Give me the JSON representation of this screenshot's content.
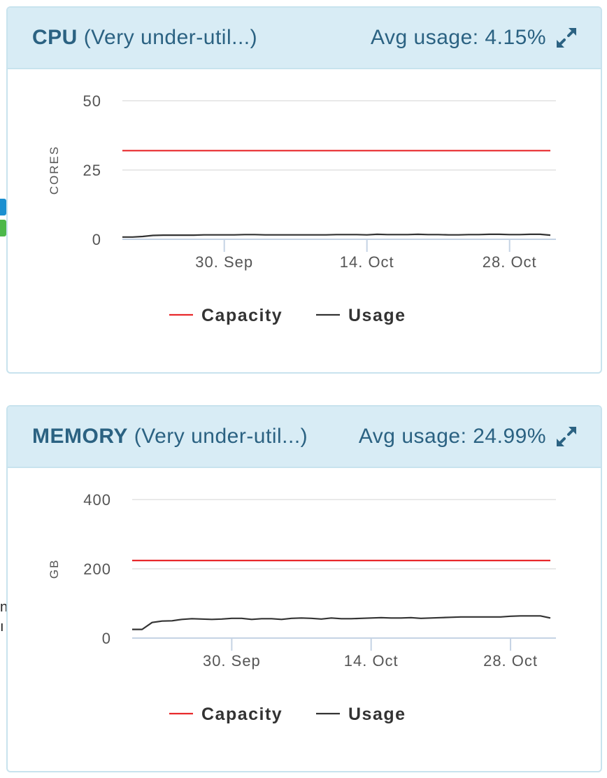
{
  "colors": {
    "capacity": "#e8292b",
    "usage": "#333333",
    "header_bg": "#d8ecf5",
    "header_text": "#2b6282",
    "edge_blue": "#1a8fd0",
    "edge_green": "#4cb84a"
  },
  "icons": {
    "expand": "expand-arrows-icon"
  },
  "edge_fragments": [
    "n",
    "ı"
  ],
  "panels": [
    {
      "name": "CPU",
      "status": "(Very under-util...)",
      "avg_usage_text": "Avg usage: 4.15%"
    },
    {
      "name": "MEMORY",
      "status": "(Very under-util...)",
      "avg_usage_text": "Avg usage: 24.99%"
    }
  ],
  "chart_data": [
    {
      "type": "line",
      "title": "CPU (Very under-util...)",
      "xlabel": "",
      "ylabel": "CORES",
      "ylim": [
        0,
        50
      ],
      "yticks": [
        0,
        25,
        50
      ],
      "xticks": [
        "30. Sep",
        "14. Oct",
        "28. Oct"
      ],
      "grid": true,
      "legend": "bottom-center",
      "series": [
        {
          "name": "Capacity",
          "color": "#e8292b",
          "x": [
            "2019-09-20",
            "2019-11-01"
          ],
          "values": [
            32,
            32
          ]
        },
        {
          "name": "Usage",
          "color": "#333333",
          "x": [
            "2019-09-20",
            "2019-09-21",
            "2019-09-22",
            "2019-09-23",
            "2019-09-24",
            "2019-09-25",
            "2019-09-26",
            "2019-09-27",
            "2019-09-28",
            "2019-09-29",
            "2019-09-30",
            "2019-10-01",
            "2019-10-02",
            "2019-10-03",
            "2019-10-04",
            "2019-10-05",
            "2019-10-06",
            "2019-10-07",
            "2019-10-08",
            "2019-10-09",
            "2019-10-10",
            "2019-10-11",
            "2019-10-12",
            "2019-10-13",
            "2019-10-14",
            "2019-10-15",
            "2019-10-16",
            "2019-10-17",
            "2019-10-18",
            "2019-10-19",
            "2019-10-20",
            "2019-10-21",
            "2019-10-22",
            "2019-10-23",
            "2019-10-24",
            "2019-10-25",
            "2019-10-26",
            "2019-10-27",
            "2019-10-28",
            "2019-10-29",
            "2019-10-30",
            "2019-10-31",
            "2019-11-01"
          ],
          "values": [
            0.8,
            0.8,
            1.0,
            1.4,
            1.5,
            1.5,
            1.5,
            1.5,
            1.6,
            1.6,
            1.6,
            1.6,
            1.7,
            1.7,
            1.6,
            1.6,
            1.6,
            1.6,
            1.6,
            1.6,
            1.6,
            1.7,
            1.7,
            1.7,
            1.6,
            1.8,
            1.7,
            1.7,
            1.7,
            1.8,
            1.7,
            1.7,
            1.6,
            1.6,
            1.7,
            1.7,
            1.8,
            1.8,
            1.7,
            1.7,
            1.8,
            1.8,
            1.5
          ]
        }
      ]
    },
    {
      "type": "line",
      "title": "MEMORY (Very under-util...)",
      "xlabel": "",
      "ylabel": "GB",
      "ylim": [
        0,
        400
      ],
      "yticks": [
        0,
        200,
        400
      ],
      "xticks": [
        "30. Sep",
        "14. Oct",
        "28. Oct"
      ],
      "grid": true,
      "legend": "bottom-center",
      "series": [
        {
          "name": "Capacity",
          "color": "#e8292b",
          "x": [
            "2019-09-20",
            "2019-11-01"
          ],
          "values": [
            224,
            224
          ]
        },
        {
          "name": "Usage",
          "color": "#333333",
          "x": [
            "2019-09-20",
            "2019-09-21",
            "2019-09-22",
            "2019-09-23",
            "2019-09-24",
            "2019-09-25",
            "2019-09-26",
            "2019-09-27",
            "2019-09-28",
            "2019-09-29",
            "2019-09-30",
            "2019-10-01",
            "2019-10-02",
            "2019-10-03",
            "2019-10-04",
            "2019-10-05",
            "2019-10-06",
            "2019-10-07",
            "2019-10-08",
            "2019-10-09",
            "2019-10-10",
            "2019-10-11",
            "2019-10-12",
            "2019-10-13",
            "2019-10-14",
            "2019-10-15",
            "2019-10-16",
            "2019-10-17",
            "2019-10-18",
            "2019-10-19",
            "2019-10-20",
            "2019-10-21",
            "2019-10-22",
            "2019-10-23",
            "2019-10-24",
            "2019-10-25",
            "2019-10-26",
            "2019-10-27",
            "2019-10-28",
            "2019-10-29",
            "2019-10-30",
            "2019-10-31",
            "2019-11-01"
          ],
          "values": [
            25,
            25,
            45,
            49,
            50,
            54,
            56,
            55,
            54,
            55,
            57,
            57,
            54,
            56,
            56,
            54,
            57,
            58,
            57,
            55,
            58,
            56,
            56,
            57,
            58,
            59,
            58,
            58,
            59,
            57,
            58,
            59,
            60,
            61,
            61,
            61,
            61,
            61,
            63,
            64,
            64,
            64,
            58
          ]
        }
      ]
    }
  ]
}
